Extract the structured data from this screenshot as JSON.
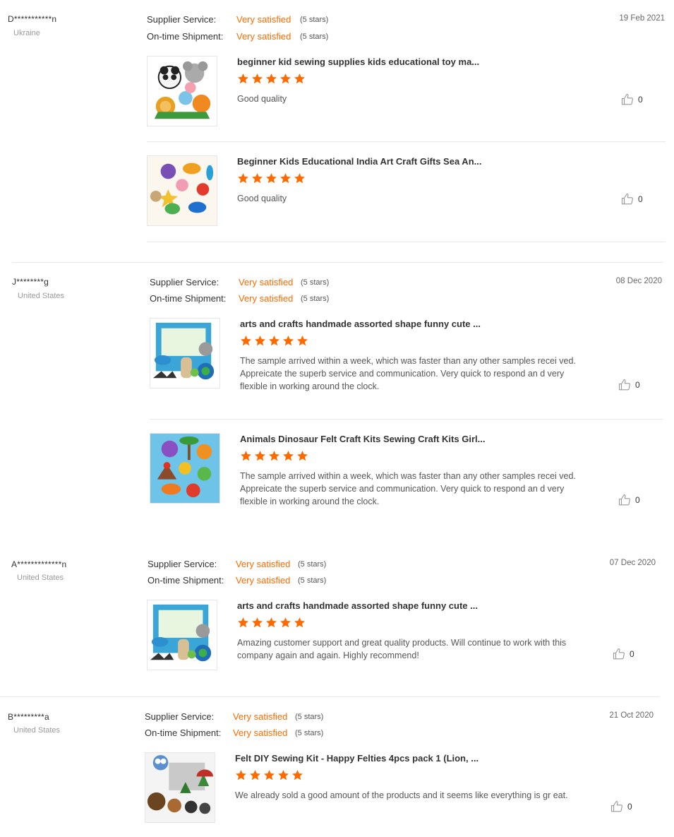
{
  "reviews": [
    {
      "name": "D***********n",
      "country": "Ukraine",
      "date": "19 Feb 2021",
      "supplier_label": "Supplier Service:",
      "supplier_value": "Very satisfied",
      "supplier_stars": "(5 stars)",
      "shipment_label": "On-time Shipment:",
      "shipment_value": "Very satisfied",
      "shipment_stars": "(5 stars)",
      "products": [
        {
          "title": "beginner kid sewing supplies kids educational toy ma...",
          "rating": 5,
          "comment": "Good quality",
          "likes": "0",
          "image": "animal-felt-kit-image"
        },
        {
          "title": "Beginner Kids Educational India Art Craft Gifts Sea An...",
          "rating": 5,
          "comment": "Good quality",
          "likes": "0",
          "image": "sea-animal-felt-kit-image"
        }
      ]
    },
    {
      "name": "J********g",
      "country": "United States",
      "date": "08 Dec 2020",
      "supplier_label": "Supplier Service:",
      "supplier_value": "Very satisfied",
      "supplier_stars": "(5 stars)",
      "shipment_label": "On-time Shipment:",
      "shipment_value": "Very satisfied",
      "shipment_stars": "(5 stars)",
      "products": [
        {
          "title": "arts and crafts handmade assorted shape funny cute ...",
          "rating": 5,
          "comment": "The sample arrived within a week, which was faster than any other samples recei ved. Appreicate the superb service and communication. Very quick to respond an d very flexible in working around the clock.",
          "likes": "0",
          "image": "craft-box-kit-image"
        },
        {
          "title": "Animals Dinosaur Felt Craft Kits Sewing Craft Kits Girl...",
          "rating": 5,
          "comment": "The sample arrived within a week, which was faster than any other samples recei ved. Appreicate the superb service and communication. Very quick to respond an d very flexible in working around the clock.",
          "likes": "0",
          "image": "dinosaur-felt-kit-image"
        }
      ]
    },
    {
      "name": "A*************n",
      "country": "United States",
      "date": "07 Dec 2020",
      "supplier_label": "Supplier Service:",
      "supplier_value": "Very satisfied",
      "supplier_stars": "(5 stars)",
      "shipment_label": "On-time Shipment:",
      "shipment_value": "Very satisfied",
      "shipment_stars": "(5 stars)",
      "products": [
        {
          "title": "arts and crafts handmade assorted shape funny cute ...",
          "rating": 5,
          "comment": "Amazing customer support and great quality products. Will continue to work with this company again and again. Highly recommend!",
          "likes": "0",
          "image": "craft-box-kit-image"
        }
      ]
    },
    {
      "name": "B*********a",
      "country": "United States",
      "date": "21 Oct 2020",
      "supplier_label": "Supplier Service:",
      "supplier_value": "Very satisfied",
      "supplier_stars": "(5 stars)",
      "shipment_label": "On-time Shipment:",
      "shipment_value": "Very satisfied",
      "shipment_stars": "(5 stars)",
      "products": [
        {
          "title": "Felt DIY Sewing Kit - Happy Felties 4pcs pack 1 (Lion, ...",
          "rating": 5,
          "comment": "We already sold a good amount of the products and it seems like everything is gr eat.",
          "likes": "0",
          "image": "woodland-felt-kit-image"
        }
      ]
    }
  ],
  "colors": {
    "accent": "#ff6a00",
    "text": "#333333",
    "muted": "#999999",
    "divider": "#e8e8e8"
  },
  "icons": {
    "star": "star-icon",
    "like": "thumbs-up-icon"
  }
}
